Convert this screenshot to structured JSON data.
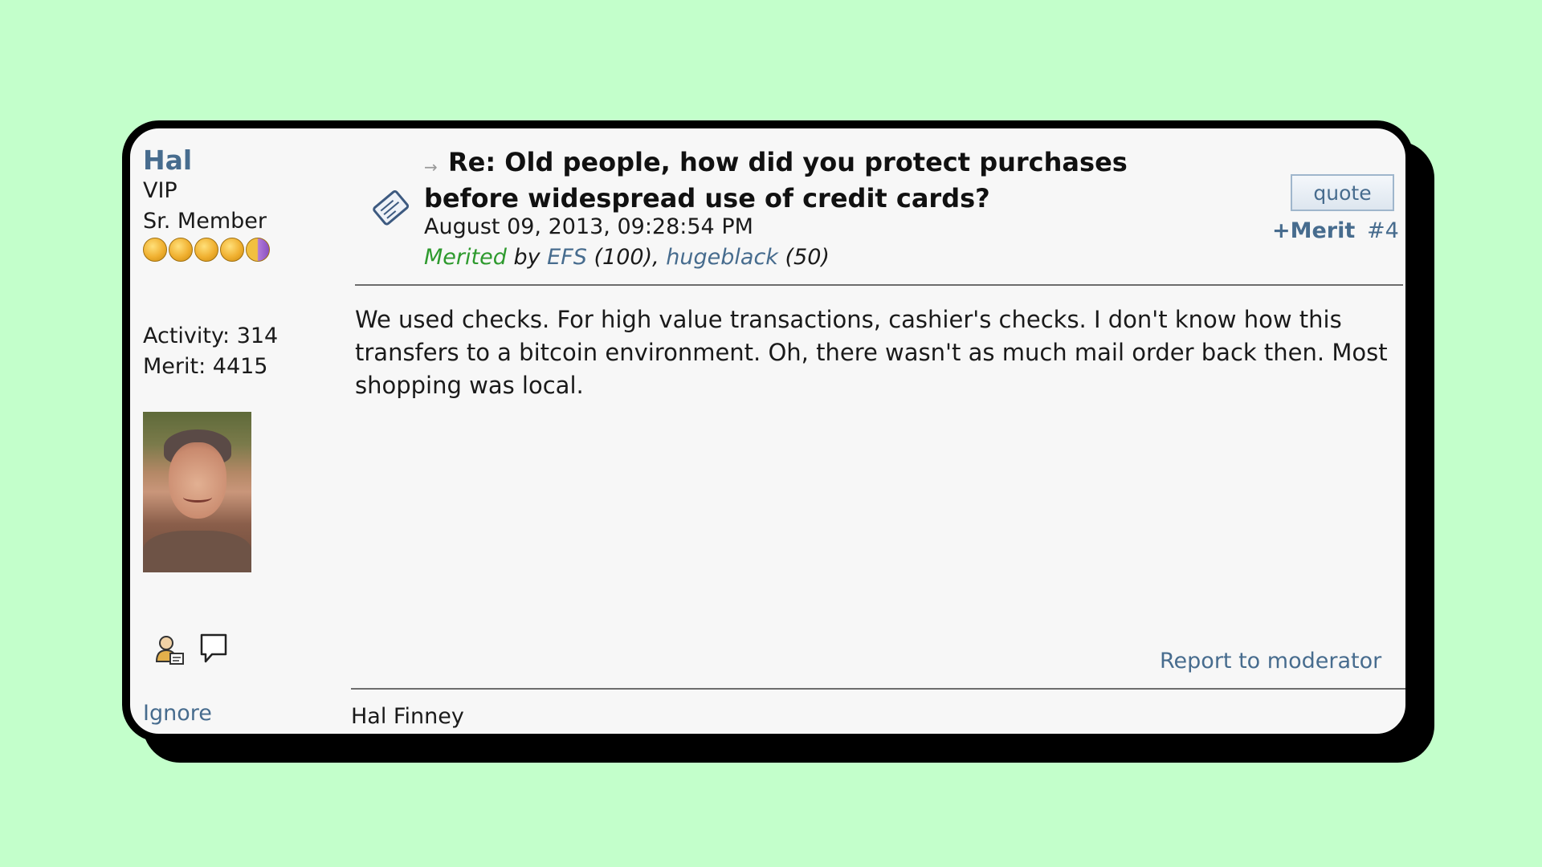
{
  "poster": {
    "name": "Hal",
    "group": "VIP",
    "rank": "Sr. Member",
    "activity": "Activity: 314",
    "merit": "Merit: 4415",
    "ignore_label": "Ignore"
  },
  "post": {
    "title": "Re: Old people, how did you protect purchases before widespread use of credit cards?",
    "date": "August 09, 2013, 09:28:54 PM",
    "merited_label": "Merited",
    "merited_by": "by",
    "merit_users": [
      {
        "name": "EFS",
        "amount": "(100),"
      },
      {
        "name": "hugeblack",
        "amount": "(50)"
      }
    ],
    "body": "We used checks. For high value transactions, cashier's checks. I don't know how this transfers to a bitcoin environment. Oh, there wasn't as much mail order back then. Most shopping was local.",
    "quote_label": "quote",
    "merit_button": "+Merit",
    "post_number": "#4",
    "report_label": "Report to moderator",
    "signature": "Hal Finney"
  },
  "colors": {
    "background": "#c3ffcb",
    "link": "#476c8e",
    "merited_green": "#2e9a2e"
  },
  "icons": {
    "post_icon": "post-document-icon",
    "profile_icon": "view-profile-icon",
    "message_icon": "send-message-icon",
    "arrow_icon": "reply-arrow-icon"
  }
}
